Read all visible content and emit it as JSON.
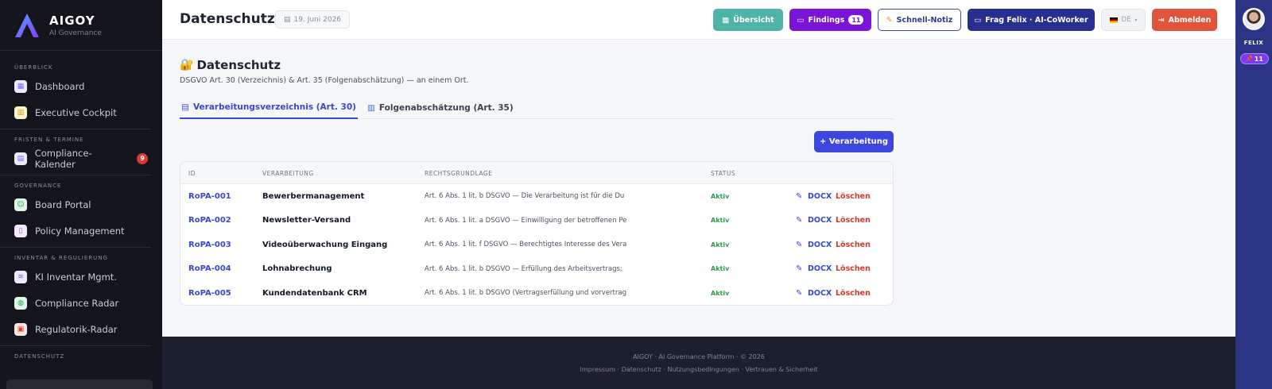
{
  "brand": {
    "name": "AIGOY",
    "sub": "AI Governance"
  },
  "sidebar": {
    "sections": [
      {
        "label": "ÜBERBLICK",
        "items": [
          {
            "label": "Dashboard",
            "icon": "grid-icon",
            "color": "#6d6af5"
          },
          {
            "label": "Executive Cockpit",
            "icon": "chart-icon",
            "color": "#f2c14e"
          }
        ]
      },
      {
        "label": "FRISTEN & TERMINE",
        "items": [
          {
            "label": "Compliance-Kalender",
            "icon": "calendar-icon",
            "color": "#6d6af5",
            "badge": "9"
          }
        ]
      },
      {
        "label": "GOVERNANCE",
        "items": [
          {
            "label": "Board Portal",
            "icon": "users-icon",
            "color": "#22c55e"
          },
          {
            "label": "Policy Management",
            "icon": "document-icon",
            "color": "#a855f7"
          }
        ]
      },
      {
        "label": "INVENTAR & REGULIERUNG",
        "items": [
          {
            "label": "KI Inventar Mgmt.",
            "icon": "database-icon",
            "color": "#6d6af5"
          },
          {
            "label": "Compliance Radar",
            "icon": "globe-icon",
            "color": "#22c55e"
          },
          {
            "label": "Regulatorik-Radar",
            "icon": "clipboard-icon",
            "color": "#ef4444"
          }
        ]
      },
      {
        "label": "DATENSCHUTZ",
        "items": []
      }
    ]
  },
  "header": {
    "title": "Datenschutz",
    "date": "19. Juni 2026",
    "overview": "Übersicht",
    "findings": "Findings",
    "findings_count": "11",
    "note": "Schnell-Notiz",
    "felix": "Frag Felix · AI-CoWorker",
    "lang": "DE",
    "logout": "Abmelden"
  },
  "rail": {
    "name": "FELIX",
    "count": "11"
  },
  "main": {
    "title": "Datenschutz",
    "description": "DSGVO Art. 30 (Verzeichnis) & Art. 35 (Folgenabschätzung) — an einem Ort.",
    "tabs": [
      {
        "label": "Verarbeitungsverzeichnis (Art. 30)"
      },
      {
        "label": "Folgenabschätzung (Art. 35)"
      }
    ],
    "add_button": "+ Verarbeitung",
    "columns": {
      "id": "ID",
      "name": "VERARBEITUNG",
      "basis": "RECHTSGRUNDLAGE",
      "status": "STATUS"
    },
    "rows": [
      {
        "id": "RoPA-001",
        "name": "Bewerbermanagement",
        "basis": "Art. 6 Abs. 1 lit. b DSGVO — Die Verarbeitung ist für die Du",
        "status": "Aktiv"
      },
      {
        "id": "RoPA-002",
        "name": "Newsletter-Versand",
        "basis": "Art. 6 Abs. 1 lit. a DSGVO — Einwilligung der betroffenen Pe",
        "status": "Aktiv"
      },
      {
        "id": "RoPA-003",
        "name": "Videoüberwachung Eingang",
        "basis": "Art. 6 Abs. 1 lit. f DSGVO — Berechtigtes Interesse des Vera",
        "status": "Aktiv"
      },
      {
        "id": "RoPA-004",
        "name": "Lohnabrechung",
        "basis": "Art. 6 Abs. 1 lit. b DSGVO — Erfüllung des Arbeitsvertrags;",
        "status": "Aktiv"
      },
      {
        "id": "RoPA-005",
        "name": "Kundendatenbank CRM",
        "basis": "Art. 6 Abs. 1 lit. b DSGVO (Vertragserfüllung und vorvertrag",
        "status": "Aktiv"
      }
    ],
    "actions": {
      "edit": "✎",
      "docx": "DOCX",
      "delete": "Löschen"
    }
  },
  "footer": {
    "line1": "AIGOY · AI Governance Platform · © 2026",
    "line2": "Impressum · Datenschutz · Nutzungsbedingungen · Vertrauen & Sicherheit"
  }
}
